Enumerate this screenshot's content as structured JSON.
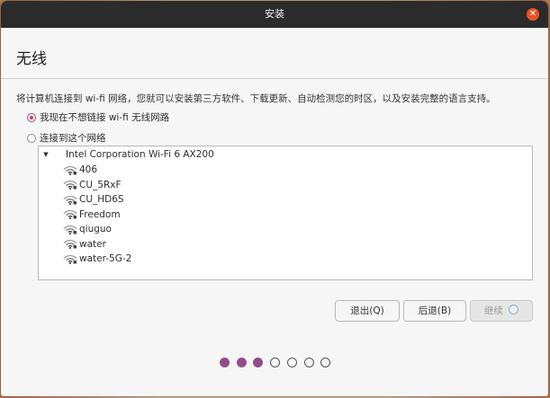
{
  "window": {
    "title": "安装",
    "close_symbol": "✕"
  },
  "page": {
    "heading": "无线",
    "description": "将计算机连接到 wi-fi 网络，您就可以安装第三方软件、下载更新、自动检测您的时区，以及安装完整的语言支持。"
  },
  "options": {
    "no_wifi_label": "我现在不想链接 wi-fi 无线网路",
    "connect_label": "连接到这个网络"
  },
  "network_list": {
    "adapter": "Intel Corporation Wi-Fi 6 AX200",
    "networks": [
      "406",
      "CU_5RxF",
      "CU_HD6S",
      "Freedom",
      "qiuguo",
      "water",
      "water-5G-2"
    ]
  },
  "buttons": {
    "quit": "退出(Q)",
    "back": "后退(B)",
    "continue": "继续"
  },
  "colors": {
    "accent": "#924d8b",
    "close": "#e95420",
    "titlebar": "#2b2b2b"
  },
  "progress": {
    "total_steps": 7,
    "completed_steps": 3
  }
}
